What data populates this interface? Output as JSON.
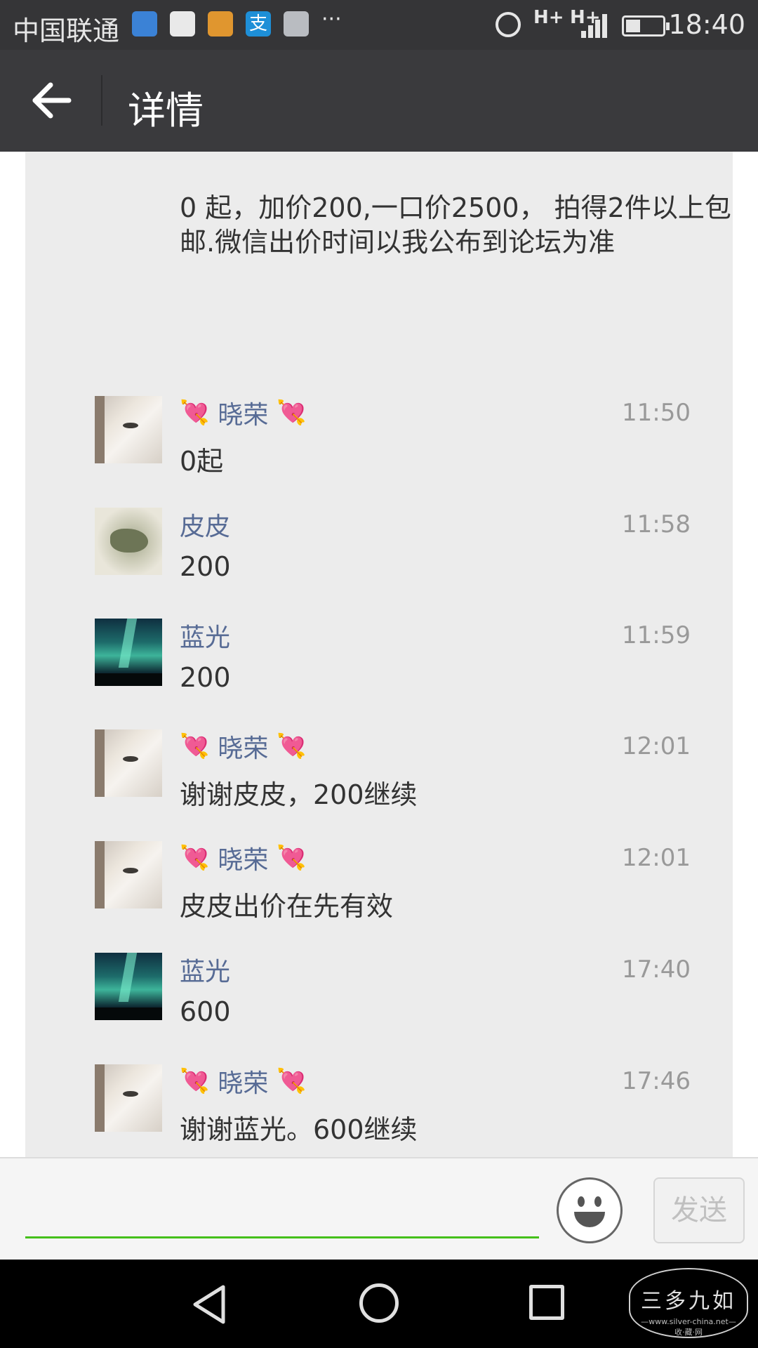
{
  "status_bar": {
    "carrier": "中国联通",
    "notification_icons": [
      "health-icon",
      "browser-icon",
      "card-icon",
      "alipay-icon",
      "gallery-icon"
    ],
    "alipay_glyph": "支",
    "more": "···",
    "network_labels": [
      "H+",
      "H+"
    ],
    "battery_level": 0.4,
    "time": "18:40"
  },
  "header": {
    "title": "详情"
  },
  "post": {
    "text": "0 起，加价200,一口价2500， 拍得2件以上包邮.微信出价时间以我公布到论坛为准"
  },
  "comments": [
    {
      "name": "晓荣",
      "heart_icons": true,
      "time": "11:50",
      "text": "0起",
      "avatar": "face"
    },
    {
      "name": "皮皮",
      "heart_icons": false,
      "time": "11:58",
      "text": "200",
      "avatar": "dragon"
    },
    {
      "name": "蓝光",
      "heart_icons": false,
      "time": "11:59",
      "text": "200",
      "avatar": "aurora"
    },
    {
      "name": "晓荣",
      "heart_icons": true,
      "time": "12:01",
      "text": "谢谢皮皮，200继续",
      "avatar": "face"
    },
    {
      "name": "晓荣",
      "heart_icons": true,
      "time": "12:01",
      "text": "皮皮出价在先有效",
      "avatar": "face"
    },
    {
      "name": "蓝光",
      "heart_icons": false,
      "time": "17:40",
      "text": "600",
      "avatar": "aurora"
    },
    {
      "name": "晓荣",
      "heart_icons": true,
      "time": "17:46",
      "text": "谢谢蓝光。600继续",
      "avatar": "face"
    }
  ],
  "input_bar": {
    "placeholder": "",
    "emoji_icon": "smiley-icon",
    "send_label": "发送"
  },
  "nav_bar": {
    "icons": [
      "back-triangle-icon",
      "home-circle-icon",
      "recent-square-icon"
    ]
  },
  "watermark": {
    "title": "三多九如",
    "url": "—www.silver-china.net—",
    "subtitle": "收·藏·网"
  },
  "colors": {
    "status_bar_bg": "#353537",
    "title_bar_bg": "#3a3a3d",
    "panel_bg": "#ececec",
    "name_link": "#576b95",
    "time_gray": "#999999",
    "input_underline": "#45c01a",
    "heart": "#e8437a"
  }
}
